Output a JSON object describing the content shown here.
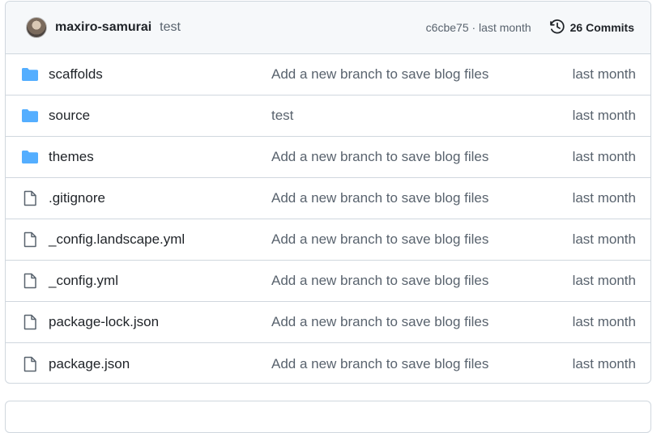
{
  "commit": {
    "author": "maxiro-samurai",
    "message": "test",
    "sha_time": "c6cbe75 · last month",
    "commits_label": "26 Commits"
  },
  "colors": {
    "folder": "#54aeff",
    "file": "#59636e"
  },
  "files": [
    {
      "type": "folder",
      "icon": "folder-icon",
      "name": "scaffolds",
      "message": "Add a new branch to save blog files",
      "time": "last month"
    },
    {
      "type": "folder",
      "icon": "folder-icon",
      "name": "source",
      "message": "test",
      "time": "last month"
    },
    {
      "type": "folder",
      "icon": "folder-icon",
      "name": "themes",
      "message": "Add a new branch to save blog files",
      "time": "last month"
    },
    {
      "type": "file",
      "icon": "file-icon",
      "name": ".gitignore",
      "message": "Add a new branch to save blog files",
      "time": "last month"
    },
    {
      "type": "file",
      "icon": "file-icon",
      "name": "_config.landscape.yml",
      "message": "Add a new branch to save blog files",
      "time": "last month"
    },
    {
      "type": "file",
      "icon": "file-icon",
      "name": "_config.yml",
      "message": "Add a new branch to save blog files",
      "time": "last month"
    },
    {
      "type": "file",
      "icon": "file-icon",
      "name": "package-lock.json",
      "message": "Add a new branch to save blog files",
      "time": "last month"
    },
    {
      "type": "file",
      "icon": "file-icon",
      "name": "package.json",
      "message": "Add a new branch to save blog files",
      "time": "last month"
    }
  ]
}
